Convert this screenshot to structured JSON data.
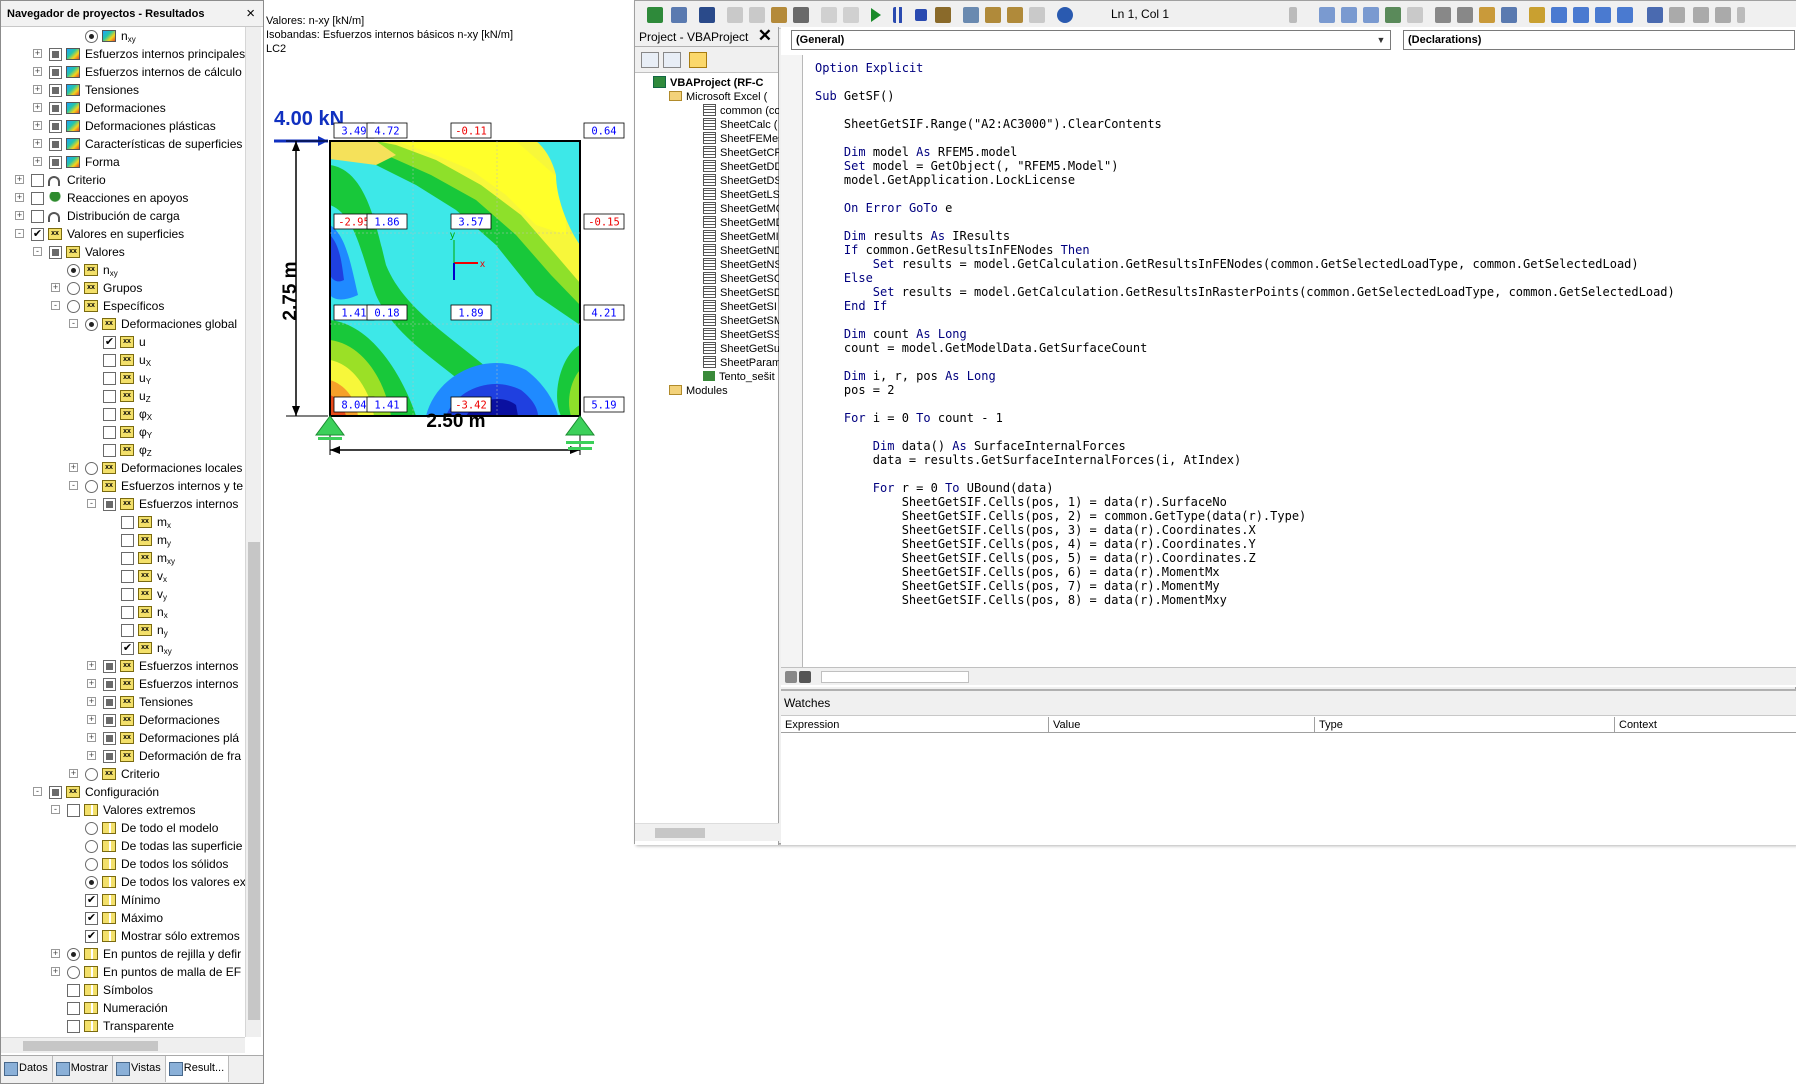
{
  "navigator": {
    "title": "Navegador de proyectos - Resultados",
    "close": "×",
    "rows": [
      {
        "lbl": "n",
        "sub": "xy",
        "lvl": 3,
        "ctl": "rd-on",
        "icon": "tri"
      },
      {
        "lbl": "Esfuerzos internos principales",
        "lvl": 1,
        "exp": "+",
        "ctl": "part",
        "icon": "tri"
      },
      {
        "lbl": "Esfuerzos internos de cálculo",
        "lvl": 1,
        "exp": "+",
        "ctl": "part",
        "icon": "tri"
      },
      {
        "lbl": "Tensiones",
        "lvl": 1,
        "exp": "+",
        "ctl": "part",
        "icon": "tri"
      },
      {
        "lbl": "Deformaciones",
        "lvl": 1,
        "exp": "+",
        "ctl": "part",
        "icon": "tri"
      },
      {
        "lbl": "Deformaciones plásticas",
        "lvl": 1,
        "exp": "+",
        "ctl": "part",
        "icon": "tri"
      },
      {
        "lbl": "Características de superficies",
        "lvl": 1,
        "exp": "+",
        "ctl": "part",
        "icon": "tri"
      },
      {
        "lbl": "Forma",
        "lvl": 1,
        "exp": "+",
        "ctl": "part",
        "icon": "tri"
      },
      {
        "lbl": "Criterio",
        "lvl": 0,
        "exp": "+",
        "ctl": "cb",
        "icon": "arc"
      },
      {
        "lbl": "Reacciones en apoyos",
        "lvl": 0,
        "exp": "+",
        "ctl": "cb",
        "icon": "tree"
      },
      {
        "lbl": "Distribución de carga",
        "lvl": 0,
        "exp": "+",
        "ctl": "cb",
        "icon": "arc"
      },
      {
        "lbl": "Valores en superficies",
        "lvl": 0,
        "exp": "-",
        "ctl": "cb-on",
        "icon": "xx"
      },
      {
        "lbl": "Valores",
        "lvl": 1,
        "exp": "-",
        "ctl": "part",
        "icon": "xx"
      },
      {
        "lbl": "n",
        "sub": "xy",
        "lvl": 2,
        "ctl": "rd-on",
        "icon": "xx"
      },
      {
        "lbl": "Grupos",
        "lvl": 2,
        "exp": "+",
        "ctl": "rd",
        "icon": "xx"
      },
      {
        "lbl": "Específicos",
        "lvl": 2,
        "exp": "-",
        "ctl": "rd",
        "icon": "xx"
      },
      {
        "lbl": "Deformaciones global",
        "lvl": 3,
        "exp": "-",
        "ctl": "rd-on",
        "icon": "xx"
      },
      {
        "lbl": "u",
        "lvl": 4,
        "ctl": "cb-on",
        "icon": "xx"
      },
      {
        "lbl": "u",
        "sub": "X",
        "lvl": 4,
        "ctl": "cb",
        "icon": "xx"
      },
      {
        "lbl": "u",
        "sub": "Y",
        "lvl": 4,
        "ctl": "cb",
        "icon": "xx"
      },
      {
        "lbl": "u",
        "sub": "Z",
        "lvl": 4,
        "ctl": "cb",
        "icon": "xx"
      },
      {
        "lbl": "φ",
        "sub": "X",
        "lvl": 4,
        "ctl": "cb",
        "icon": "xx"
      },
      {
        "lbl": "φ",
        "sub": "Y",
        "lvl": 4,
        "ctl": "cb",
        "icon": "xx"
      },
      {
        "lbl": "φ",
        "sub": "Z",
        "lvl": 4,
        "ctl": "cb",
        "icon": "xx"
      },
      {
        "lbl": "Deformaciones locales",
        "lvl": 3,
        "exp": "+",
        "ctl": "rd",
        "icon": "xx"
      },
      {
        "lbl": "Esfuerzos internos y te",
        "lvl": 3,
        "exp": "-",
        "ctl": "rd",
        "icon": "xx"
      },
      {
        "lbl": "Esfuerzos internos",
        "lvl": 4,
        "exp": "-",
        "ctl": "part",
        "icon": "xx"
      },
      {
        "lbl": "m",
        "sub": "x",
        "lvl": 5,
        "ctl": "cb",
        "icon": "xx"
      },
      {
        "lbl": "m",
        "sub": "y",
        "lvl": 5,
        "ctl": "cb",
        "icon": "xx"
      },
      {
        "lbl": "m",
        "sub": "xy",
        "lvl": 5,
        "ctl": "cb",
        "icon": "xx"
      },
      {
        "lbl": "v",
        "sub": "x",
        "lvl": 5,
        "ctl": "cb",
        "icon": "xx"
      },
      {
        "lbl": "v",
        "sub": "y",
        "lvl": 5,
        "ctl": "cb",
        "icon": "xx"
      },
      {
        "lbl": "n",
        "sub": "x",
        "lvl": 5,
        "ctl": "cb",
        "icon": "xx"
      },
      {
        "lbl": "n",
        "sub": "y",
        "lvl": 5,
        "ctl": "cb",
        "icon": "xx"
      },
      {
        "lbl": "n",
        "sub": "xy",
        "lvl": 5,
        "ctl": "cb-on",
        "icon": "xx"
      },
      {
        "lbl": "Esfuerzos internos",
        "lvl": 4,
        "exp": "+",
        "ctl": "part",
        "icon": "xx"
      },
      {
        "lbl": "Esfuerzos internos",
        "lvl": 4,
        "exp": "+",
        "ctl": "part",
        "icon": "xx"
      },
      {
        "lbl": "Tensiones",
        "lvl": 4,
        "exp": "+",
        "ctl": "part",
        "icon": "xx"
      },
      {
        "lbl": "Deformaciones",
        "lvl": 4,
        "exp": "+",
        "ctl": "part",
        "icon": "xx"
      },
      {
        "lbl": "Deformaciones plá",
        "lvl": 4,
        "exp": "+",
        "ctl": "part",
        "icon": "xx"
      },
      {
        "lbl": "Deformación de fra",
        "lvl": 4,
        "exp": "+",
        "ctl": "part",
        "icon": "xx"
      },
      {
        "lbl": "Criterio",
        "lvl": 3,
        "exp": "+",
        "ctl": "rd",
        "icon": "xx"
      },
      {
        "lbl": "Configuración",
        "lvl": 1,
        "exp": "-",
        "ctl": "part",
        "icon": "xx"
      },
      {
        "lbl": "Valores extremos",
        "lvl": 2,
        "exp": "-",
        "ctl": "cb",
        "icon": "grid4"
      },
      {
        "lbl": "De todo el modelo",
        "lvl": 3,
        "ctl": "rd",
        "icon": "grid4"
      },
      {
        "lbl": "De todas las superficie",
        "lvl": 3,
        "ctl": "rd",
        "icon": "grid4"
      },
      {
        "lbl": "De todos los sólidos",
        "lvl": 3,
        "ctl": "rd",
        "icon": "grid4"
      },
      {
        "lbl": "De todos los valores ex",
        "lvl": 3,
        "ctl": "rd-on",
        "icon": "grid4"
      },
      {
        "lbl": "Mínimo",
        "lvl": 3,
        "ctl": "cb-on",
        "icon": "grid4"
      },
      {
        "lbl": "Máximo",
        "lvl": 3,
        "ctl": "cb-on",
        "icon": "grid4"
      },
      {
        "lbl": "Mostrar sólo extremos",
        "lvl": 3,
        "ctl": "cb-on",
        "icon": "grid4"
      },
      {
        "lbl": "En puntos de rejilla y defir",
        "lvl": 2,
        "exp": "+",
        "ctl": "rd-on",
        "icon": "grid4"
      },
      {
        "lbl": "En puntos de malla de EF",
        "lvl": 2,
        "exp": "+",
        "ctl": "rd",
        "icon": "grid4"
      },
      {
        "lbl": "Símbolos",
        "lvl": 2,
        "ctl": "cb",
        "icon": "grid4"
      },
      {
        "lbl": "Numeración",
        "lvl": 2,
        "ctl": "cb",
        "icon": "grid4"
      },
      {
        "lbl": "Transparente",
        "lvl": 2,
        "ctl": "cb",
        "icon": "grid4"
      }
    ],
    "tabs": [
      "Datos",
      "Mostrar",
      "Vistas",
      "Result..."
    ]
  },
  "plot": {
    "line1": "Valores: n-xy [kN/m]",
    "line2": "Isobandas: Esfuerzos internos básicos n-xy [kN/m]",
    "line3": "LC2",
    "load": "4.00 kN",
    "height": "2.75 m",
    "width": "2.50 m",
    "axis_x": "x",
    "axis_y": "y",
    "values": [
      {
        "t": "3.49",
        "c": "#00f"
      },
      {
        "t": "4.72",
        "c": "#00f"
      },
      {
        "t": "-0.11",
        "c": "#e00"
      },
      {
        "t": "0.64",
        "c": "#00f"
      },
      {
        "t": "-2.95",
        "c": "#e00"
      },
      {
        "t": "1.86",
        "c": "#00f"
      },
      {
        "t": "3.57",
        "c": "#00f"
      },
      {
        "t": "-0.15",
        "c": "#e00"
      },
      {
        "t": "1.41",
        "c": "#00f"
      },
      {
        "t": "0.18",
        "c": "#00f"
      },
      {
        "t": "1.89",
        "c": "#00f"
      },
      {
        "t": "4.21",
        "c": "#00f"
      },
      {
        "t": "8.04",
        "c": "#00f"
      },
      {
        "t": "1.41",
        "c": "#00f"
      },
      {
        "t": "-3.42",
        "c": "#e00"
      },
      {
        "t": "5.19",
        "c": "#00f"
      }
    ]
  },
  "vbe": {
    "position": "Ln 1, Col 1",
    "project_title": "Project - VBAProject",
    "project_items": [
      "VBAProject (RF-C",
      "Microsoft Excel (",
      "common (co",
      "SheetCalc (",
      "SheetFEMes",
      "SheetGetCR",
      "SheetGetDD",
      "SheetGetDS",
      "SheetGetLS",
      "SheetGetMC",
      "SheetGetMD",
      "SheetGetMI",
      "SheetGetND",
      "SheetGetNS",
      "SheetGetSC",
      "SheetGetSD",
      "SheetGetSI",
      "SheetGetSM",
      "SheetGetSS",
      "SheetGetSu",
      "SheetParam",
      "Tento_sešit",
      "Modules"
    ],
    "combo_left": "(General)",
    "combo_right": "(Declarations)",
    "code": [
      "Option Explicit",
      "",
      "Sub GetSF()",
      "",
      "    SheetGetSIF.Range(\"A2:AC3000\").ClearContents",
      "",
      "    Dim model As RFEM5.model",
      "    Set model = GetObject(, \"RFEM5.Model\")",
      "    model.GetApplication.LockLicense",
      "",
      "    On Error GoTo e",
      "",
      "    Dim results As IResults",
      "    If common.GetResultsInFENodes Then",
      "        Set results = model.GetCalculation.GetResultsInFENodes(common.GetSelectedLoadType, common.GetSelectedLoad)",
      "    Else",
      "        Set results = model.GetCalculation.GetResultsInRasterPoints(common.GetSelectedLoadType, common.GetSelectedLoad)",
      "    End If",
      "",
      "    Dim count As Long",
      "    count = model.GetModelData.GetSurfaceCount",
      "",
      "    Dim i, r, pos As Long",
      "    pos = 2",
      "",
      "    For i = 0 To count - 1",
      "",
      "        Dim data() As SurfaceInternalForces",
      "        data = results.GetSurfaceInternalForces(i, AtIndex)",
      "",
      "        For r = 0 To UBound(data)",
      "            SheetGetSIF.Cells(pos, 1) = data(r).SurfaceNo",
      "            SheetGetSIF.Cells(pos, 2) = common.GetType(data(r).Type)",
      "            SheetGetSIF.Cells(pos, 3) = data(r).Coordinates.X",
      "            SheetGetSIF.Cells(pos, 4) = data(r).Coordinates.Y",
      "            SheetGetSIF.Cells(pos, 5) = data(r).Coordinates.Z",
      "            SheetGetSIF.Cells(pos, 6) = data(r).MomentMx",
      "            SheetGetSIF.Cells(pos, 7) = data(r).MomentMy",
      "            SheetGetSIF.Cells(pos, 8) = data(r).MomentMxy"
    ],
    "watches_title": "Watches",
    "watch_cols": [
      "Expression",
      "Value",
      "Type",
      "Context"
    ]
  }
}
